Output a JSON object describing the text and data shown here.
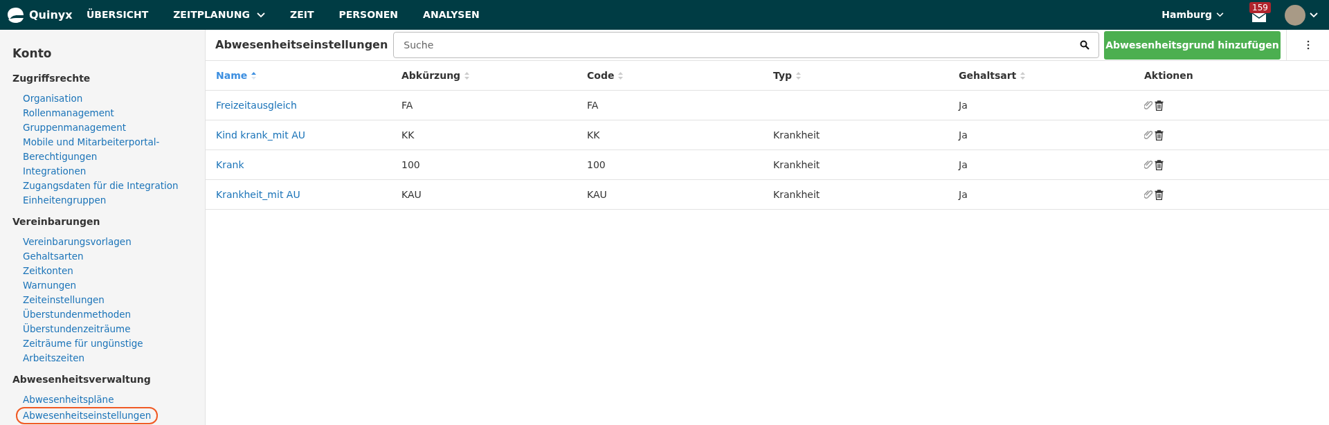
{
  "topbar": {
    "logo": "Quinyx",
    "nav": [
      {
        "label": "ÜBERSICHT",
        "dropdown": false
      },
      {
        "label": "ZEITPLANUNG",
        "dropdown": true
      },
      {
        "label": "ZEIT",
        "dropdown": false
      },
      {
        "label": "PERSONEN",
        "dropdown": false
      },
      {
        "label": "ANALYSEN",
        "dropdown": false
      }
    ],
    "location": "Hamburg",
    "notification_count": "159"
  },
  "sidebar": {
    "title": "Konto",
    "sections": [
      {
        "heading": "Zugriffsrechte",
        "items": [
          {
            "label": "Organisation",
            "selected": false
          },
          {
            "label": "Rollenmanagement",
            "selected": false
          },
          {
            "label": "Gruppenmanagement",
            "selected": false
          },
          {
            "label": "Mobile und Mitarbeiterportal-Berechtigungen",
            "selected": false
          },
          {
            "label": "Integrationen",
            "selected": false
          },
          {
            "label": "Zugangsdaten für die Integration",
            "selected": false
          },
          {
            "label": "Einheitengruppen",
            "selected": false
          }
        ]
      },
      {
        "heading": "Vereinbarungen",
        "items": [
          {
            "label": "Vereinbarungsvorlagen",
            "selected": false
          },
          {
            "label": "Gehaltsarten",
            "selected": false
          },
          {
            "label": "Zeitkonten",
            "selected": false
          },
          {
            "label": "Warnungen",
            "selected": false
          },
          {
            "label": "Zeiteinstellungen",
            "selected": false
          },
          {
            "label": "Überstundenmethoden",
            "selected": false
          },
          {
            "label": "Überstundenzeiträume",
            "selected": false
          },
          {
            "label": "Zeiträume für ungünstige",
            "selected": false
          },
          {
            "label": "Arbeitszeiten",
            "selected": false
          }
        ]
      },
      {
        "heading": "Abwesenheitsverwaltung",
        "items": [
          {
            "label": "Abwesenheitspläne",
            "selected": false
          },
          {
            "label": "Abwesenheitseinstellungen",
            "selected": true
          }
        ]
      }
    ]
  },
  "content": {
    "title": "Abwesenheitseinstellungen",
    "search": {
      "placeholder": "Suche"
    },
    "add_button": "Abwesenheitsgrund hinzufügen",
    "table": {
      "columns": [
        {
          "label": "Name",
          "sortable": true,
          "sorted": true
        },
        {
          "label": "Abkürzung",
          "sortable": true,
          "sorted": false
        },
        {
          "label": "Code",
          "sortable": true,
          "sorted": false
        },
        {
          "label": "Typ",
          "sortable": true,
          "sorted": false
        },
        {
          "label": "Gehaltsart",
          "sortable": true,
          "sorted": false
        },
        {
          "label": "Aktionen",
          "sortable": false,
          "sorted": false
        }
      ],
      "rows": [
        {
          "name": "Freizeitausgleich",
          "abbreviation": "FA",
          "code": "FA",
          "salary_type": "Ja"
        },
        {
          "name": "Kind krank_mit AU",
          "abbreviation": "KK",
          "code": "KK",
          "type": "Krankheit",
          "salary_type": "Ja"
        },
        {
          "name": "Krank",
          "abbreviation": "100",
          "code": "100",
          "type": "Krankheit",
          "salary_type": "Ja"
        },
        {
          "name": "Krankheit_mit AU",
          "abbreviation": "KAU",
          "code": "KAU",
          "type": "Krankheit",
          "salary_type": "Ja"
        }
      ]
    }
  }
}
